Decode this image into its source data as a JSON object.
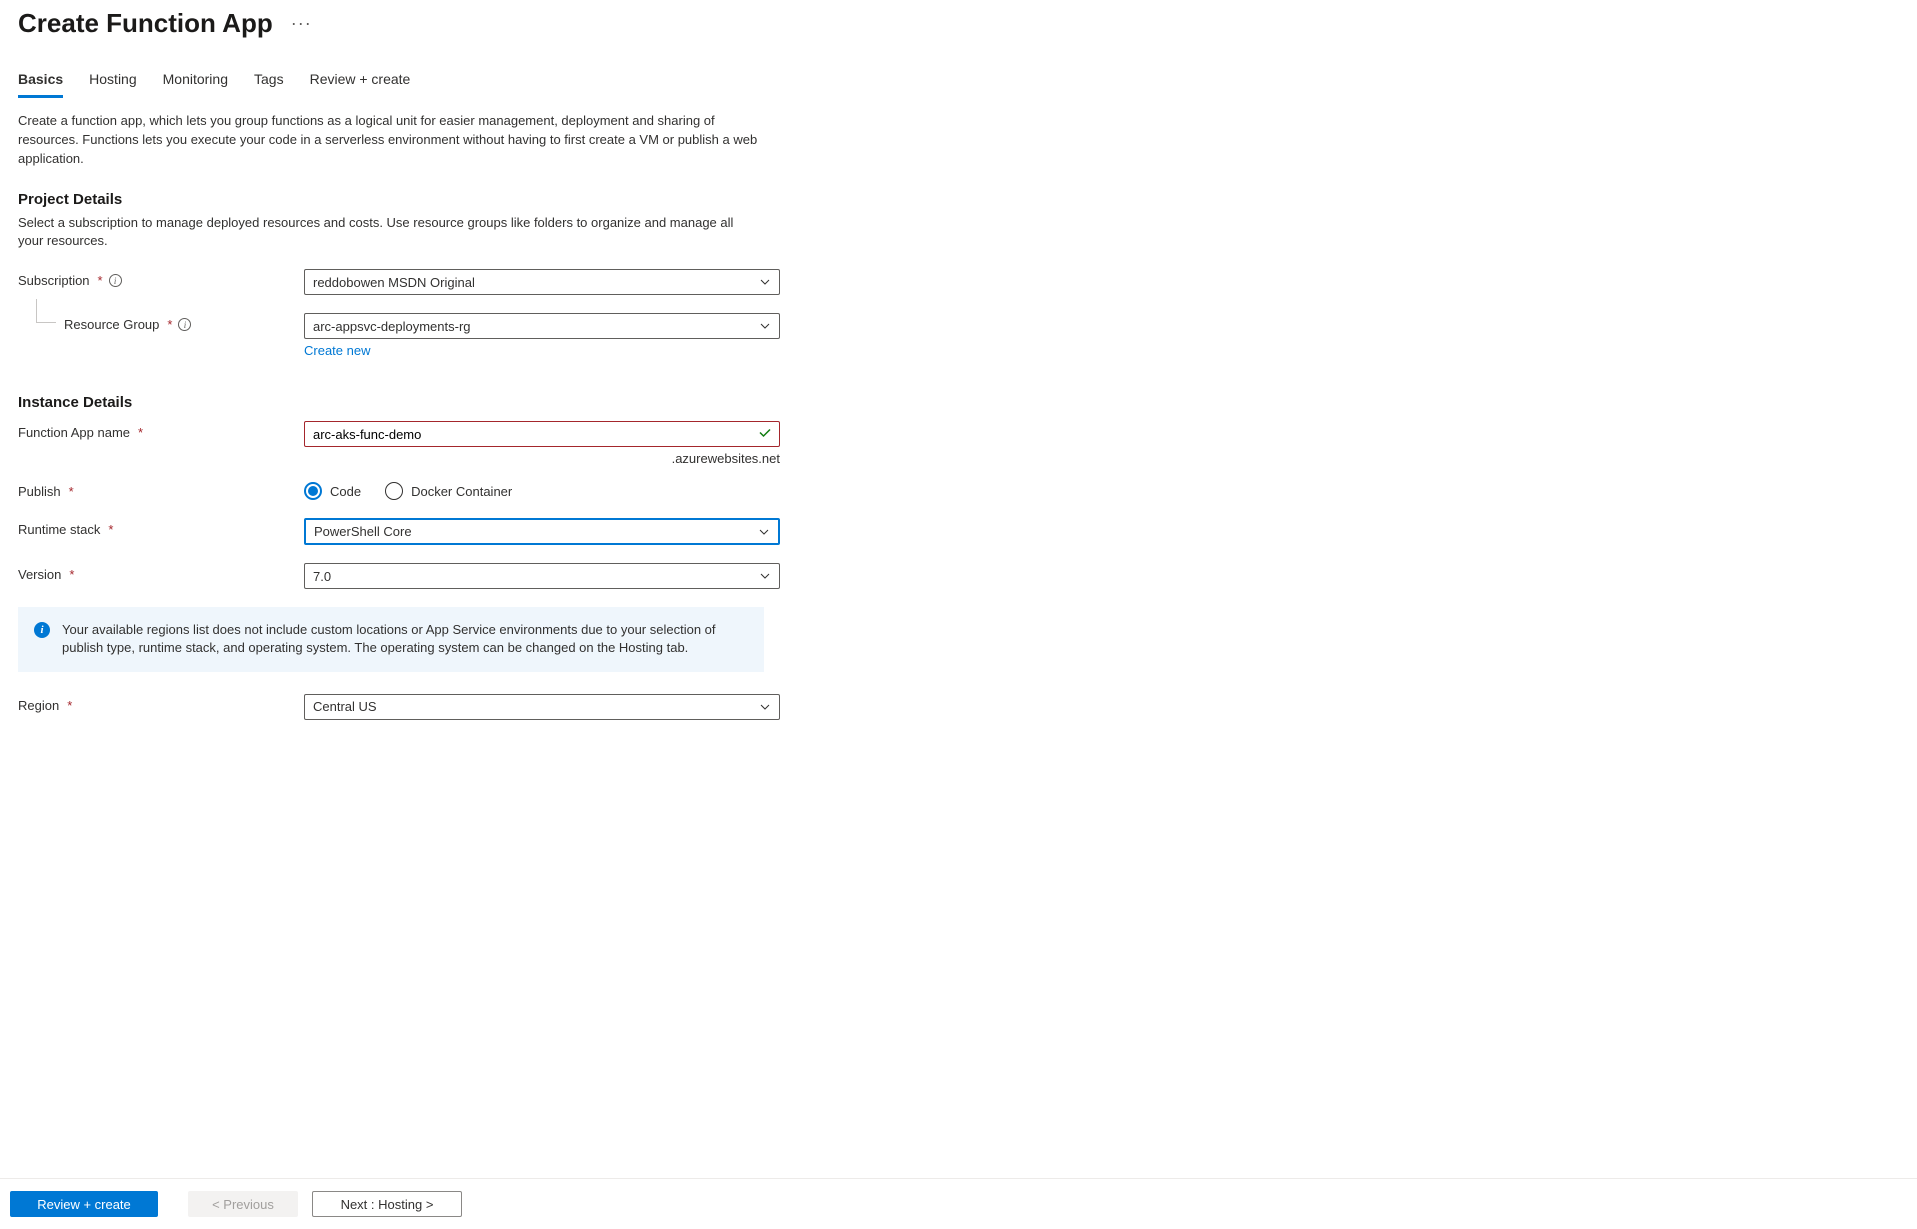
{
  "page": {
    "title": "Create Function App"
  },
  "tabs": {
    "basics": "Basics",
    "hosting": "Hosting",
    "monitoring": "Monitoring",
    "tags": "Tags",
    "review": "Review + create"
  },
  "intro": "Create a function app, which lets you group functions as a logical unit for easier management, deployment and sharing of resources. Functions lets you execute your code in a serverless environment without having to first create a VM or publish a web application.",
  "project": {
    "heading": "Project Details",
    "desc": "Select a subscription to manage deployed resources and costs. Use resource groups like folders to organize and manage all your resources.",
    "subscription_label": "Subscription",
    "subscription_value": "reddobowen MSDN Original",
    "rg_label": "Resource Group",
    "rg_value": "arc-appsvc-deployments-rg",
    "create_new": "Create new"
  },
  "instance": {
    "heading": "Instance Details",
    "name_label": "Function App name",
    "name_value": "arc-aks-func-demo",
    "name_suffix": ".azurewebsites.net",
    "publish_label": "Publish",
    "publish_code": "Code",
    "publish_docker": "Docker Container",
    "runtime_label": "Runtime stack",
    "runtime_value": "PowerShell Core",
    "version_label": "Version",
    "version_value": "7.0"
  },
  "banner": {
    "text": "Your available regions list does not include custom locations or App Service environments due to your selection of publish type, runtime stack, and operating system. The operating system can be changed on the Hosting tab."
  },
  "region": {
    "label": "Region",
    "value": "Central US"
  },
  "footer": {
    "review": "Review + create",
    "previous": "< Previous",
    "next": "Next : Hosting >"
  }
}
